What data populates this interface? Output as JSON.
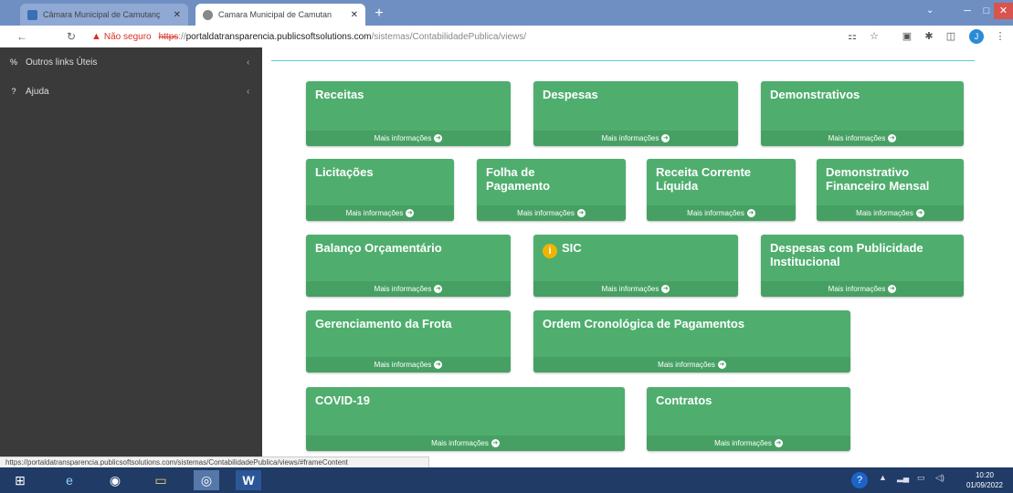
{
  "browser": {
    "tabs": [
      {
        "title": "Câmara Municipal de Camutanç"
      },
      {
        "title": "Camara Municipal de Camutan"
      }
    ],
    "security_label": "Não seguro",
    "url_scheme": "https",
    "url_sep": "://",
    "url_host": "portaldatransparencia.publicsoftsolutions.com",
    "url_path": "/sistemas/ContabilidadePublica/views/",
    "profile_initial": "J"
  },
  "sidebar": {
    "items": [
      {
        "icon": "link-icon",
        "label": "Outros links Úteis"
      },
      {
        "icon": "question-icon",
        "label": "Ajuda"
      }
    ]
  },
  "tiles": {
    "more_label": "Mais informações",
    "items": [
      {
        "title": "Receitas"
      },
      {
        "title": "Despesas"
      },
      {
        "title": "Demonstrativos"
      },
      {
        "title": "Licitações"
      },
      {
        "title": "Folha de Pagamento"
      },
      {
        "title": "Receita Corrente Líquida"
      },
      {
        "title": "Demonstrativo Financeiro Mensal"
      },
      {
        "title": "Balanço Orçamentário"
      },
      {
        "title": "SIC"
      },
      {
        "title": "Despesas com Publicidade Institucional"
      },
      {
        "title": "Gerenciamento da Frota"
      },
      {
        "title": "Ordem Cronológica de Pagamentos"
      },
      {
        "title": "COVID-19"
      },
      {
        "title": "Contratos"
      }
    ]
  },
  "status_url": "https://portaldatransparencia.publicsoftsolutions.com/sistemas/ContabilidadePublica/views/#frameContent",
  "taskbar": {
    "time": "10:20",
    "date": "01/09/2022"
  }
}
